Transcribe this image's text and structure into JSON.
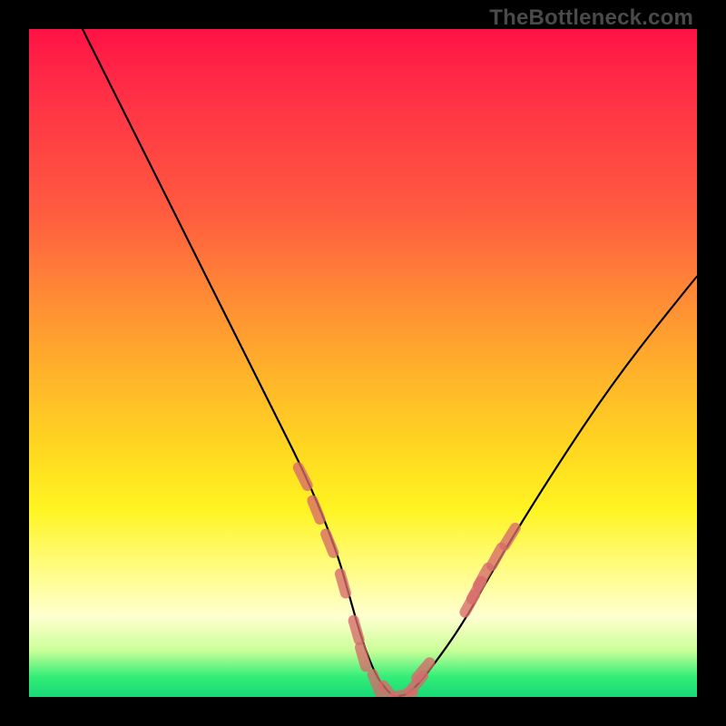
{
  "watermark": "TheBottleneck.com",
  "chart_data": {
    "type": "line",
    "title": "",
    "xlabel": "",
    "ylabel": "",
    "xlim": [
      0,
      100
    ],
    "ylim": [
      0,
      100
    ],
    "grid": false,
    "legend": false,
    "series": [
      {
        "name": "bottleneck-curve",
        "x": [
          8,
          12,
          18,
          24,
          30,
          36,
          42,
          46,
          48,
          50,
          52,
          54,
          55,
          57,
          60,
          65,
          70,
          78,
          88,
          100
        ],
        "y": [
          100,
          92,
          80,
          68,
          56,
          44,
          32,
          22,
          15,
          8,
          3,
          0.5,
          0,
          0.5,
          4,
          11,
          20,
          33,
          48,
          63
        ]
      }
    ],
    "markers": {
      "name": "highlighted-points",
      "style": "dash-capsule",
      "color": "#d76b6b",
      "points": [
        {
          "x": 41,
          "y": 33
        },
        {
          "x": 43,
          "y": 28
        },
        {
          "x": 45,
          "y": 23
        },
        {
          "x": 47,
          "y": 17
        },
        {
          "x": 49,
          "y": 10
        },
        {
          "x": 50,
          "y": 6
        },
        {
          "x": 52,
          "y": 2
        },
        {
          "x": 54,
          "y": 0.5
        },
        {
          "x": 56,
          "y": 0.3
        },
        {
          "x": 58,
          "y": 2
        },
        {
          "x": 59,
          "y": 4
        },
        {
          "x": 66,
          "y": 14
        },
        {
          "x": 67,
          "y": 16
        },
        {
          "x": 68,
          "y": 18
        },
        {
          "x": 70,
          "y": 21
        },
        {
          "x": 72,
          "y": 24
        }
      ]
    },
    "background_gradient": {
      "type": "linear-vertical",
      "stops": [
        {
          "pos": 0.0,
          "color": "#ff1245"
        },
        {
          "pos": 0.28,
          "color": "#ff5d3f"
        },
        {
          "pos": 0.52,
          "color": "#ffb42a"
        },
        {
          "pos": 0.72,
          "color": "#fff423"
        },
        {
          "pos": 0.88,
          "color": "#ffffd0"
        },
        {
          "pos": 1.0,
          "color": "#18d878"
        }
      ]
    }
  }
}
